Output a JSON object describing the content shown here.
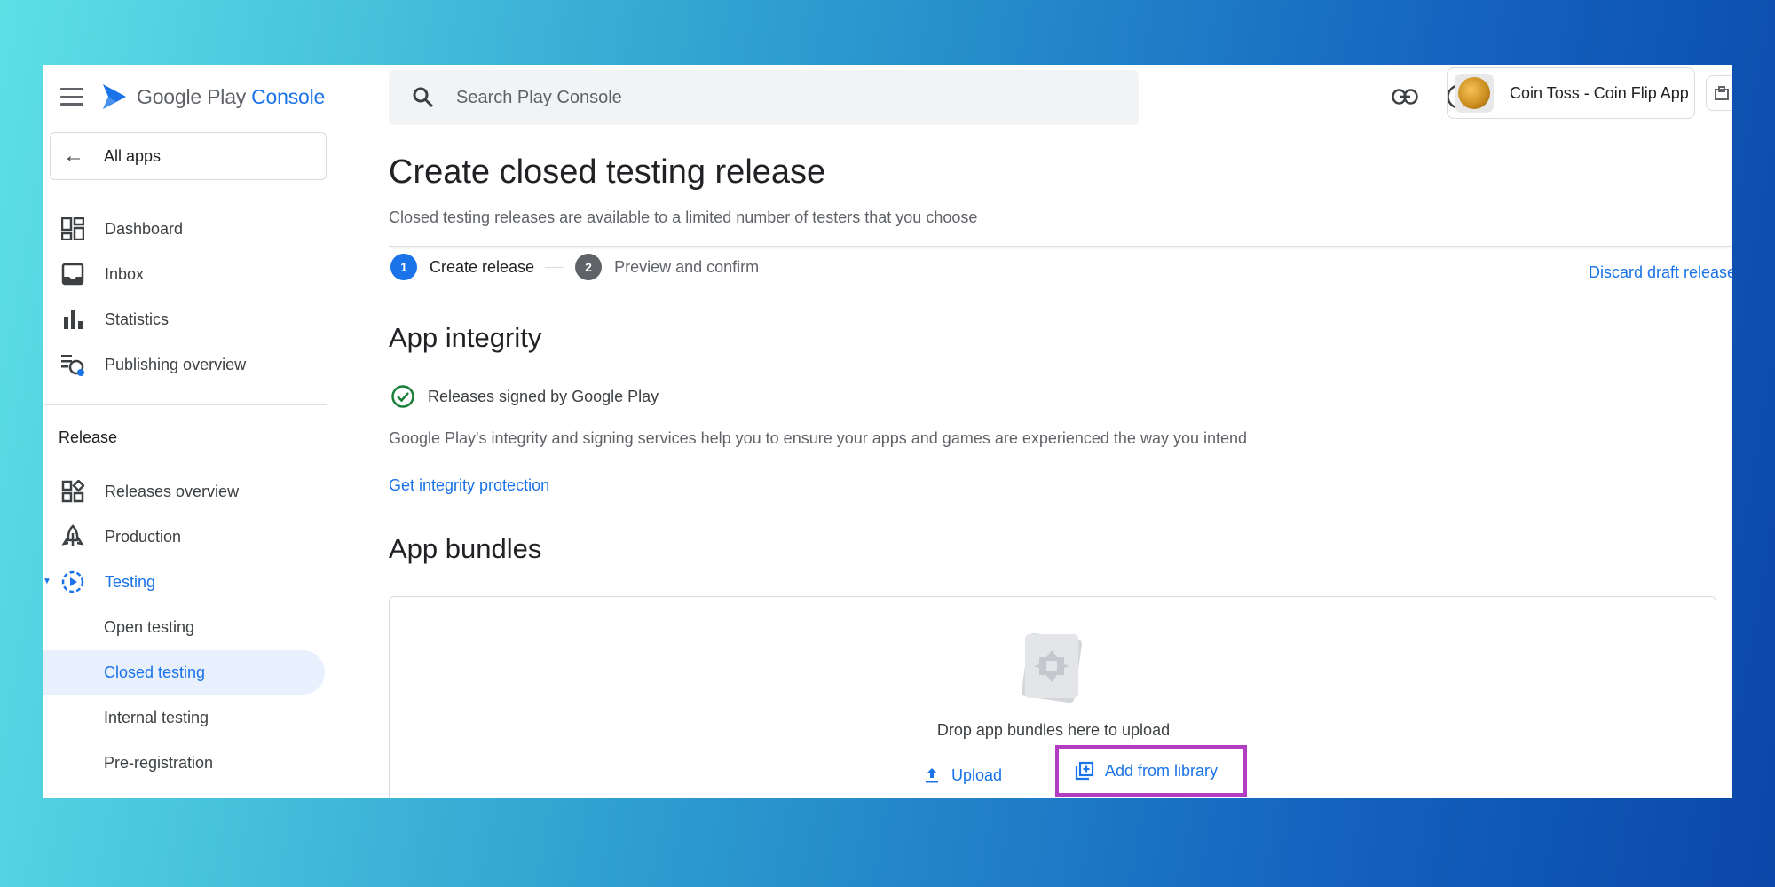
{
  "brand": {
    "name": "Google Play",
    "product": "Console"
  },
  "sidebar": {
    "all_apps": "All apps",
    "items": [
      {
        "label": "Dashboard",
        "icon": "dashboard-icon"
      },
      {
        "label": "Inbox",
        "icon": "inbox-icon"
      },
      {
        "label": "Statistics",
        "icon": "bar-chart-icon"
      },
      {
        "label": "Publishing overview",
        "icon": "publishing-overview-icon"
      }
    ],
    "section_label": "Release",
    "release_items": [
      {
        "label": "Releases overview",
        "icon": "releases-overview-icon"
      },
      {
        "label": "Production",
        "icon": "rocket-icon"
      },
      {
        "label": "Testing",
        "icon": "testing-icon"
      }
    ],
    "testing_sub": [
      {
        "label": "Open testing"
      },
      {
        "label": "Closed testing",
        "selected": true
      },
      {
        "label": "Internal testing"
      },
      {
        "label": "Pre-registration"
      }
    ]
  },
  "search": {
    "placeholder": "Search Play Console"
  },
  "header": {
    "app_name": "Coin Toss - Coin Flip App"
  },
  "page": {
    "title": "Create closed testing release",
    "subtitle": "Closed testing releases are available to a limited number of testers that you choose",
    "steps": [
      {
        "num": "1",
        "label": "Create release"
      },
      {
        "num": "2",
        "label": "Preview and confirm"
      }
    ],
    "discard_label": "Discard draft release"
  },
  "integrity": {
    "heading": "App integrity",
    "status": "Releases signed by Google Play",
    "description": "Google Play's integrity and signing services help you to ensure your apps and games are experienced the way you intend",
    "link": "Get integrity protection"
  },
  "bundles": {
    "heading": "App bundles",
    "drop_text": "Drop app bundles here to upload",
    "upload_label": "Upload",
    "library_label": "Add from library"
  },
  "colors": {
    "accent": "#1a73e8",
    "highlight": "#b23cc2",
    "success": "#188038"
  }
}
